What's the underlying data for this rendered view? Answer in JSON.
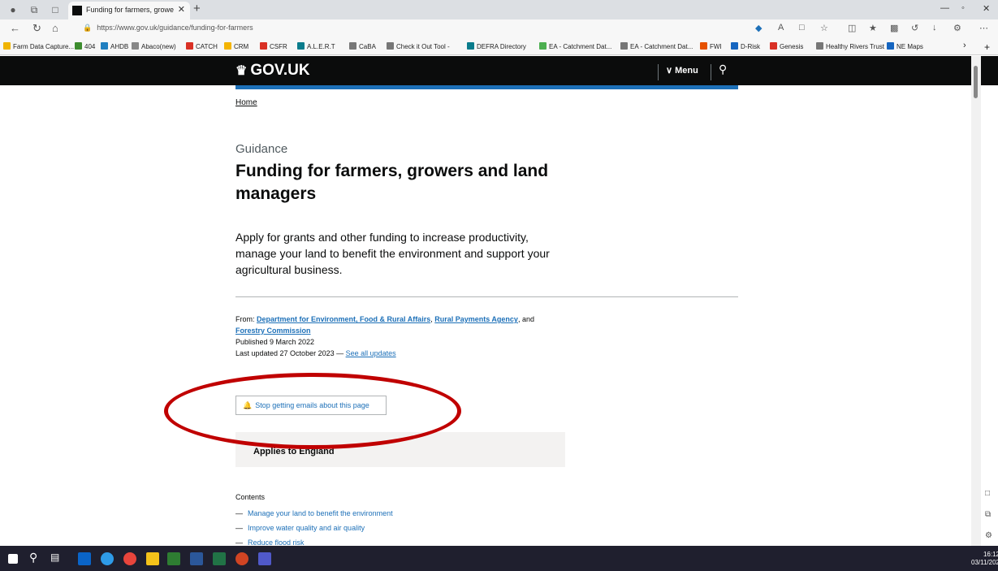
{
  "browser": {
    "tab_title": "Funding for farmers, growers and",
    "url": "https://www.gov.uk/guidance/funding-for-farmers",
    "bookmarks": [
      {
        "label": "Farm Data Capture...",
        "color": "#f0b400"
      },
      {
        "label": "404",
        "color": "#3d8c2e"
      },
      {
        "label": "AHDB",
        "color": "#1f7fc0"
      },
      {
        "label": "Abaco(new)",
        "color": "#888888"
      },
      {
        "label": "CATCH",
        "color": "#d93025"
      },
      {
        "label": "CRM",
        "color": "#f4b400"
      },
      {
        "label": "CSFR",
        "color": "#d93025"
      },
      {
        "label": "A.L.E.R.T",
        "color": "#0a7c8c"
      },
      {
        "label": "CaBA",
        "color": "#777777"
      },
      {
        "label": "Check it Out Tool -",
        "color": "#777777"
      },
      {
        "label": "DEFRA Directory",
        "color": "#0a7c8c"
      },
      {
        "label": "EA - Catchment Dat...",
        "color": "#4caf50"
      },
      {
        "label": "EA - Catchment Dat...",
        "color": "#777777"
      },
      {
        "label": "FWI",
        "color": "#e65100"
      },
      {
        "label": "D-Risk",
        "color": "#1565c0"
      },
      {
        "label": "Genesis",
        "color": "#d93025"
      },
      {
        "label": "Healthy Rivers Trust",
        "color": "#777777"
      },
      {
        "label": "NE Maps",
        "color": "#1565c0"
      }
    ]
  },
  "header": {
    "logo": "GOV.UK",
    "menu_label": "Menu"
  },
  "page": {
    "breadcrumb": "Home",
    "caption": "Guidance",
    "title": "Funding for farmers, growers and land managers",
    "lede": "Apply for grants and other funding to increase productivity, manage your land to benefit the environment and support your agricultural business.",
    "from_label": "From:",
    "org1": "Department for Environment, Food & Rural Affairs",
    "org_sep1": ",",
    "org2": "Rural Payments Agency",
    "org_sep2": ", and",
    "org3": "Forestry Commission",
    "published": "Published 9 March 2022",
    "last_updated": "Last updated 27 October 2023 —",
    "see_all_updates": "See all updates",
    "stop_emails": "Stop getting emails about this page",
    "applies_to": "Applies to England",
    "contents_heading": "Contents",
    "contents": [
      "Manage your land to benefit the environment",
      "Improve water quality and air quality",
      "Reduce flood risk"
    ]
  },
  "taskbar": {
    "time": "16:12",
    "date": "03/11/202"
  },
  "colors": {
    "gov_black": "#0b0c0c",
    "gov_blue": "#1d70b8",
    "annotation_red": "#c00000"
  }
}
